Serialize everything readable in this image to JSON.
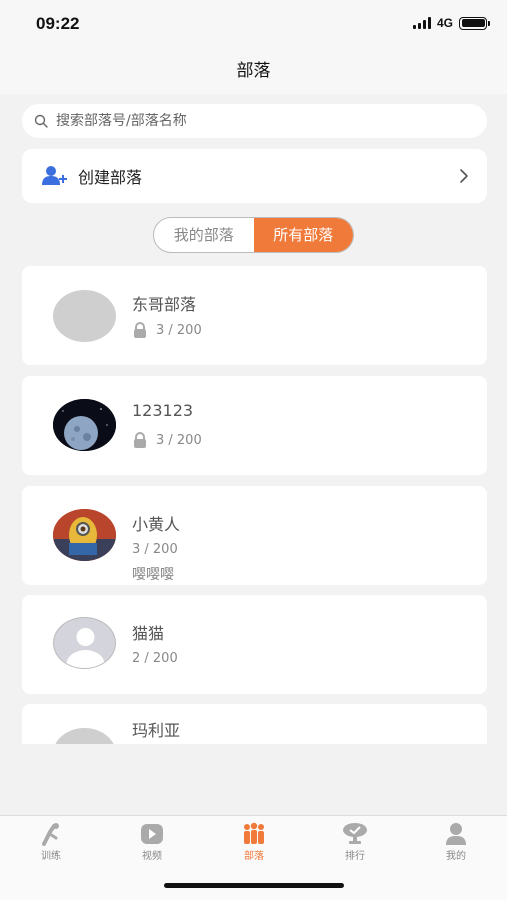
{
  "status_bar": {
    "time": "09:22",
    "network": "4G"
  },
  "nav": {
    "title": "部落"
  },
  "search": {
    "placeholder": "搜索部落号/部落名称"
  },
  "create": {
    "label": "创建部落"
  },
  "segments": [
    {
      "label": "我的部落",
      "active": false
    },
    {
      "label": "所有部落",
      "active": true
    }
  ],
  "tribes": [
    {
      "name": "东哥部落",
      "count": "3 / 200",
      "locked": true,
      "avatar": "gray-placeholder"
    },
    {
      "name": "123123",
      "count": "3 / 200",
      "locked": true,
      "avatar": "moon-photo"
    },
    {
      "name": "小黄人",
      "count": "3 / 200",
      "locked": false,
      "desc": "嘤嘤嘤",
      "avatar": "minion-photo"
    },
    {
      "name": "猫猫",
      "count": "2 / 200",
      "locked": false,
      "avatar": "default-user"
    },
    {
      "name": "玛利亚",
      "count": "",
      "locked": false,
      "avatar": "gray-placeholder"
    }
  ],
  "tabs": [
    {
      "label": "训练",
      "icon": "training-icon",
      "active": false
    },
    {
      "label": "视频",
      "icon": "video-icon",
      "active": false
    },
    {
      "label": "部落",
      "icon": "tribe-icon",
      "active": true
    },
    {
      "label": "排行",
      "icon": "trophy-icon",
      "active": false
    },
    {
      "label": "我的",
      "icon": "user-icon",
      "active": false
    }
  ],
  "colors": {
    "accent": "#f07a3a",
    "icon_blue": "#3b6fe0",
    "tab_gray": "#aaaaaa"
  }
}
